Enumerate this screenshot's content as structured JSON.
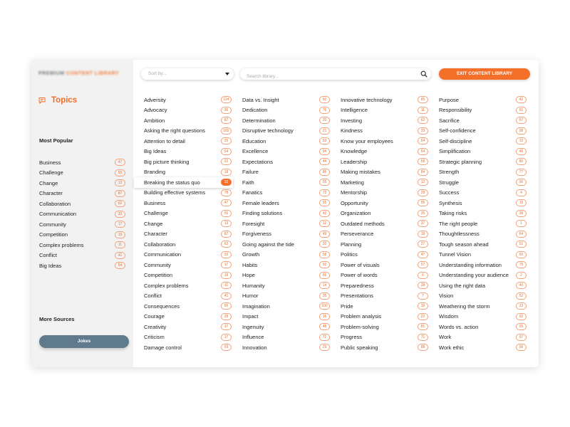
{
  "sidebar": {
    "logo_main": "PREMIUM",
    "logo_accent": "CONTENT LIBRARY",
    "topics_title": "Topics",
    "most_popular_title": "Most Popular",
    "most_popular": [
      {
        "label": "Business",
        "count": "47"
      },
      {
        "label": "Challenge",
        "count": "55"
      },
      {
        "label": "Change",
        "count": "13"
      },
      {
        "label": "Character",
        "count": "87"
      },
      {
        "label": "Collaboration",
        "count": "62"
      },
      {
        "label": "Communication",
        "count": "33"
      },
      {
        "label": "Community",
        "count": "17"
      },
      {
        "label": "Competition",
        "count": "19"
      },
      {
        "label": "Complex problems",
        "count": "11"
      },
      {
        "label": "Conflict",
        "count": "41"
      },
      {
        "label": "Big Ideas",
        "count": "54"
      }
    ],
    "more_sources_title": "More Sources",
    "jokes_label": "Jokes"
  },
  "toolbar": {
    "sort_placeholder": "Sort by...",
    "search_placeholder": "Search library...",
    "exit_label": "EXIT CONTENT LIBRARY"
  },
  "selected_topic": "Breaking the status quo",
  "columns": [
    [
      {
        "label": "Adversity",
        "count": "124"
      },
      {
        "label": "Advocacy",
        "count": "36"
      },
      {
        "label": "Ambition",
        "count": "87"
      },
      {
        "label": "Asking the right questions",
        "count": "102"
      },
      {
        "label": "Attention to detail",
        "count": "25"
      },
      {
        "label": "Big Ideas",
        "count": "54"
      },
      {
        "label": "Big picture thinking",
        "count": "22"
      },
      {
        "label": "Branding",
        "count": "18"
      },
      {
        "label": "Breaking the status quo",
        "count": "32"
      },
      {
        "label": "Building effective systems",
        "count": "78"
      },
      {
        "label": "Business",
        "count": "47"
      },
      {
        "label": "Challenge",
        "count": "55"
      },
      {
        "label": "Change",
        "count": "13"
      },
      {
        "label": "Character",
        "count": "87"
      },
      {
        "label": "Collaboration",
        "count": "62"
      },
      {
        "label": "Communication",
        "count": "33"
      },
      {
        "label": "Community",
        "count": "17"
      },
      {
        "label": "Competition",
        "count": "19"
      },
      {
        "label": "Complex problems",
        "count": "11"
      },
      {
        "label": "Conflict",
        "count": "41"
      },
      {
        "label": "Consequences",
        "count": "66"
      },
      {
        "label": "Courage",
        "count": "28"
      },
      {
        "label": "Creativity",
        "count": "17"
      },
      {
        "label": "Criticism",
        "count": "17"
      },
      {
        "label": "Damage control",
        "count": "59"
      }
    ],
    [
      {
        "label": "Data vs. Insight",
        "count": "60"
      },
      {
        "label": "Dedication",
        "count": "76"
      },
      {
        "label": "Determination",
        "count": "20"
      },
      {
        "label": "Disruptive technology",
        "count": "21"
      },
      {
        "label": "Education",
        "count": "53"
      },
      {
        "label": "Excellence",
        "count": "94"
      },
      {
        "label": "Expectations",
        "count": "44"
      },
      {
        "label": "Failure",
        "count": "86"
      },
      {
        "label": "Faith",
        "count": "55"
      },
      {
        "label": "Fanatics",
        "count": "73"
      },
      {
        "label": "Female leaders",
        "count": "55"
      },
      {
        "label": "Finding solutions",
        "count": "43"
      },
      {
        "label": "Foresight",
        "count": "12"
      },
      {
        "label": "Forgiveness",
        "count": "49"
      },
      {
        "label": "Going against the tide",
        "count": "20"
      },
      {
        "label": "Growth",
        "count": "58"
      },
      {
        "label": "Habits",
        "count": "93"
      },
      {
        "label": "Hope",
        "count": "66"
      },
      {
        "label": "Humanity",
        "count": "14"
      },
      {
        "label": "Humor",
        "count": "35"
      },
      {
        "label": "Imagination",
        "count": "100"
      },
      {
        "label": "Impact",
        "count": "16"
      },
      {
        "label": "Ingenuity",
        "count": "48"
      },
      {
        "label": "Influence",
        "count": "72"
      },
      {
        "label": "Innovation",
        "count": "29"
      }
    ],
    [
      {
        "label": "Innovative technology",
        "count": "85"
      },
      {
        "label": "Intelligence",
        "count": "11"
      },
      {
        "label": "Investing",
        "count": "62"
      },
      {
        "label": "Kindness",
        "count": "33"
      },
      {
        "label": "Know your employees",
        "count": "64"
      },
      {
        "label": "Knowledge",
        "count": "54"
      },
      {
        "label": "Leadership",
        "count": "68"
      },
      {
        "label": "Making mistakes",
        "count": "84"
      },
      {
        "label": "Marketing",
        "count": "12"
      },
      {
        "label": "Mentorship",
        "count": "28"
      },
      {
        "label": "Opportunity",
        "count": "95"
      },
      {
        "label": "Organization",
        "count": "35"
      },
      {
        "label": "Outdated methods",
        "count": "37"
      },
      {
        "label": "Perseverance",
        "count": "18"
      },
      {
        "label": "Planning",
        "count": "27"
      },
      {
        "label": "Politics",
        "count": "47"
      },
      {
        "label": "Power of visuals",
        "count": "57"
      },
      {
        "label": "Power of words",
        "count": "6"
      },
      {
        "label": "Preparedness",
        "count": "28"
      },
      {
        "label": "Presentations",
        "count": "7"
      },
      {
        "label": "Pride",
        "count": "19"
      },
      {
        "label": "Problem analysis",
        "count": "22"
      },
      {
        "label": "Problem-solving",
        "count": "81"
      },
      {
        "label": "Progress",
        "count": "71"
      },
      {
        "label": "Public speaking",
        "count": "88"
      }
    ],
    [
      {
        "label": "Purpose",
        "count": "42"
      },
      {
        "label": "Responsibility",
        "count": "91"
      },
      {
        "label": "Sacrifice",
        "count": "67"
      },
      {
        "label": "Self-confidence",
        "count": "98"
      },
      {
        "label": "Self-discipline",
        "count": "10"
      },
      {
        "label": "Simplification",
        "count": "46"
      },
      {
        "label": "Strategic planning",
        "count": "80"
      },
      {
        "label": "Strength",
        "count": "77"
      },
      {
        "label": "Struggle",
        "count": "90"
      },
      {
        "label": "Success",
        "count": "4"
      },
      {
        "label": "Synthesis",
        "count": "15"
      },
      {
        "label": "Taking risks",
        "count": "38"
      },
      {
        "label": "The right people",
        "count": "1"
      },
      {
        "label": "Thoughtlessness",
        "count": "64"
      },
      {
        "label": "Tough season ahead",
        "count": "51"
      },
      {
        "label": "Tunnel Vision",
        "count": "60"
      },
      {
        "label": "Understanding information",
        "count": "75"
      },
      {
        "label": "Understanding your audience",
        "count": "2"
      },
      {
        "label": "Using the right data",
        "count": "40"
      },
      {
        "label": "Vision",
        "count": "52"
      },
      {
        "label": "Weathering the storm",
        "count": "23"
      },
      {
        "label": "Wisdom",
        "count": "92"
      },
      {
        "label": "Words vs. action",
        "count": "25"
      },
      {
        "label": "Work",
        "count": "97"
      },
      {
        "label": "Work ethic",
        "count": "99"
      }
    ]
  ],
  "colors": {
    "accent": "#f36f2a",
    "badge_border": "#f2a27a",
    "sidebar_bg": "#f2f2f2",
    "jokes_button": "#5e7a8c"
  },
  "icons": {
    "topics": "chat-bubble-icon",
    "search": "magnifier-icon",
    "sort": "chevron-down-icon"
  }
}
